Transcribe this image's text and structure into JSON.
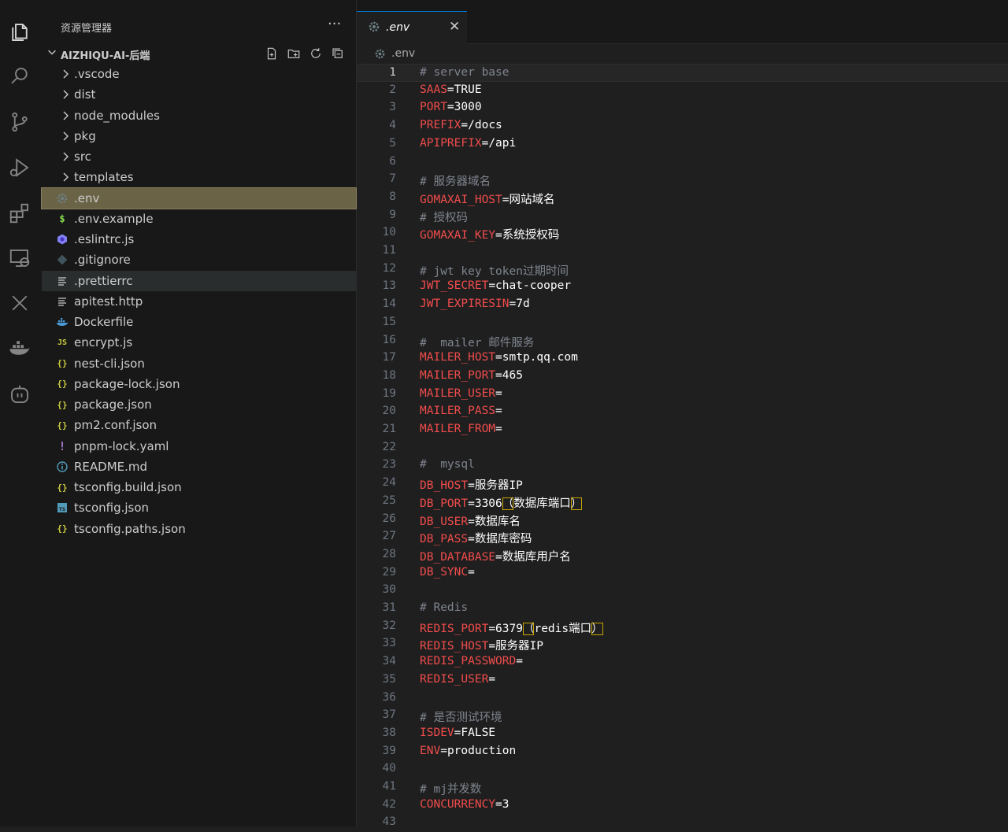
{
  "explorer": {
    "title": "资源管理器",
    "more": "···",
    "project": "AIZHIQU-AI-后端",
    "items": [
      {
        "type": "folder",
        "label": ".vscode"
      },
      {
        "type": "folder",
        "label": "dist"
      },
      {
        "type": "folder",
        "label": "node_modules"
      },
      {
        "type": "folder",
        "label": "pkg"
      },
      {
        "type": "folder",
        "label": "src"
      },
      {
        "type": "folder",
        "label": "templates"
      },
      {
        "type": "env",
        "label": ".env",
        "state": "selected"
      },
      {
        "type": "dollar",
        "label": ".env.example",
        "glyph": "$"
      },
      {
        "type": "eslint",
        "label": ".eslintrc.js"
      },
      {
        "type": "git",
        "label": ".gitignore"
      },
      {
        "type": "lines",
        "label": ".prettierrc",
        "state": "hover"
      },
      {
        "type": "lines",
        "label": "apitest.http"
      },
      {
        "type": "docker",
        "label": "Dockerfile"
      },
      {
        "type": "js",
        "label": "encrypt.js",
        "glyph": "JS"
      },
      {
        "type": "json",
        "label": "nest-cli.json",
        "glyph": "{}"
      },
      {
        "type": "json",
        "label": "package-lock.json",
        "glyph": "{}"
      },
      {
        "type": "json",
        "label": "package.json",
        "glyph": "{}"
      },
      {
        "type": "json",
        "label": "pm2.conf.json",
        "glyph": "{}"
      },
      {
        "type": "yaml",
        "label": "pnpm-lock.yaml",
        "glyph": "!"
      },
      {
        "type": "info",
        "label": "README.md",
        "glyph": "i"
      },
      {
        "type": "json",
        "label": "tsconfig.build.json",
        "glyph": "{}"
      },
      {
        "type": "ts",
        "label": "tsconfig.json",
        "glyph": "TS"
      },
      {
        "type": "json",
        "label": "tsconfig.paths.json",
        "glyph": "{}"
      }
    ]
  },
  "tab": {
    "label": ".env",
    "close": "✕"
  },
  "breadcrumb": ".env",
  "editor": {
    "current_line": 1,
    "lines": [
      {
        "n": "1",
        "c": "# server base"
      },
      {
        "n": "2",
        "k": "SAAS",
        "v": "TRUE"
      },
      {
        "n": "3",
        "k": "PORT",
        "v": "3000"
      },
      {
        "n": "4",
        "k": "PREFIX",
        "v": "/docs"
      },
      {
        "n": "5",
        "k": "APIPREFIX",
        "v": "/api"
      },
      {
        "n": "6"
      },
      {
        "n": "7",
        "c": "# 服务器域名"
      },
      {
        "n": "8",
        "k": "GOMAXAI_HOST",
        "v": "网站域名"
      },
      {
        "n": "9",
        "c": "# 授权码"
      },
      {
        "n": "10",
        "k": "GOMAXAI_KEY",
        "v": "系统授权码"
      },
      {
        "n": "11"
      },
      {
        "n": "12",
        "c": "# jwt key token过期时间"
      },
      {
        "n": "13",
        "k": "JWT_SECRET",
        "v": "chat-cooper"
      },
      {
        "n": "14",
        "k": "JWT_EXPIRESIN",
        "v": "7d"
      },
      {
        "n": "15"
      },
      {
        "n": "16",
        "c": "#  mailer 邮件服务"
      },
      {
        "n": "17",
        "k": "MAILER_HOST",
        "v": "smtp.qq.com"
      },
      {
        "n": "18",
        "k": "MAILER_PORT",
        "v": "465"
      },
      {
        "n": "19",
        "k": "MAILER_USER",
        "v": ""
      },
      {
        "n": "20",
        "k": "MAILER_PASS",
        "v": ""
      },
      {
        "n": "21",
        "k": "MAILER_FROM",
        "v": ""
      },
      {
        "n": "22"
      },
      {
        "n": "23",
        "c": "#  mysql"
      },
      {
        "n": "24",
        "k": "DB_HOST",
        "v": "服务器IP"
      },
      {
        "n": "25",
        "k": "DB_PORT",
        "v": "3306",
        "lp": "（",
        "note": "数据库端口",
        "rp": "）"
      },
      {
        "n": "26",
        "k": "DB_USER",
        "v": "数据库名"
      },
      {
        "n": "27",
        "k": "DB_PASS",
        "v": "数据库密码"
      },
      {
        "n": "28",
        "k": "DB_DATABASE",
        "v": "数据库用户名"
      },
      {
        "n": "29",
        "k": "DB_SYNC",
        "v": ""
      },
      {
        "n": "30"
      },
      {
        "n": "31",
        "c": "# Redis"
      },
      {
        "n": "32",
        "k": "REDIS_PORT",
        "v": "6379",
        "lp": "（",
        "note": "redis端口",
        "rp": "）"
      },
      {
        "n": "33",
        "k": "REDIS_HOST",
        "v": "服务器IP"
      },
      {
        "n": "34",
        "k": "REDIS_PASSWORD",
        "v": ""
      },
      {
        "n": "35",
        "k": "REDIS_USER",
        "v": ""
      },
      {
        "n": "36"
      },
      {
        "n": "37",
        "c": "# 是否测试环境"
      },
      {
        "n": "38",
        "k": "ISDEV",
        "v": "FALSE"
      },
      {
        "n": "39",
        "k": "ENV",
        "v": "production"
      },
      {
        "n": "40"
      },
      {
        "n": "41",
        "c": "# mj并发数"
      },
      {
        "n": "42",
        "k": "CONCURRENCY",
        "v": "3"
      },
      {
        "n": "43"
      }
    ]
  },
  "colors": {
    "key": "#f14c4c",
    "comment": "#7f848e",
    "selection": "#6a6346",
    "json_icon": "#cbcb41",
    "js_icon": "#cbcb41",
    "yaml_icon": "#a074c4",
    "info_icon": "#519aba",
    "env_icon": "#6d8086",
    "dollar_icon": "#89e051",
    "docker_icon": "#4a9ad8"
  }
}
